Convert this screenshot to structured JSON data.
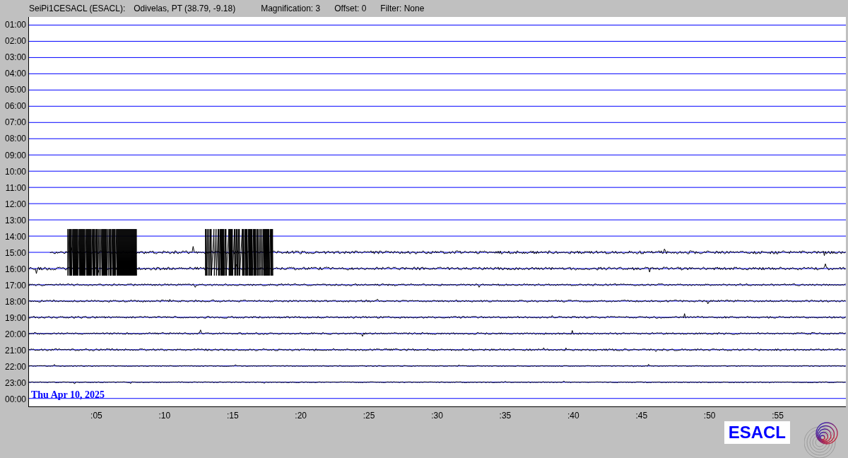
{
  "header": {
    "station": "SeiPi1CESACL (ESACL):",
    "location": "Odivelas, PT (38.79, -9.18)",
    "magnification": "Magnification: 3",
    "offset": "Offset: 0",
    "filter": "Filter: None"
  },
  "rows": [
    {
      "time": "01:00",
      "trace": false
    },
    {
      "time": "02:00",
      "trace": false
    },
    {
      "time": "03:00",
      "trace": false
    },
    {
      "time": "04:00",
      "trace": false
    },
    {
      "time": "05:00",
      "trace": false
    },
    {
      "time": "06:00",
      "trace": false
    },
    {
      "time": "07:00",
      "trace": false
    },
    {
      "time": "08:00",
      "trace": false
    },
    {
      "time": "09:00",
      "trace": false
    },
    {
      "time": "10:00",
      "trace": false
    },
    {
      "time": "11:00",
      "trace": false
    },
    {
      "time": "12:00",
      "trace": false
    },
    {
      "time": "13:00",
      "trace": false
    },
    {
      "time": "14:00",
      "trace": false
    },
    {
      "time": "15:00",
      "trace": true
    },
    {
      "time": "16:00",
      "trace": true
    },
    {
      "time": "17:00",
      "trace": true
    },
    {
      "time": "18:00",
      "trace": true
    },
    {
      "time": "19:00",
      "trace": true
    },
    {
      "time": "20:00",
      "trace": true
    },
    {
      "time": "21:00",
      "trace": true
    },
    {
      "time": "22:00",
      "trace": true
    },
    {
      "time": "23:00",
      "trace": true
    },
    {
      "time": "00:00",
      "trace": false
    }
  ],
  "date": "Thu Apr 10, 2025",
  "x_ticks": [
    ":05",
    ":10",
    ":15",
    ":20",
    ":25",
    ":30",
    ":35",
    ":40",
    ":45",
    ":50",
    ":55"
  ],
  "logo": "ESACL"
}
